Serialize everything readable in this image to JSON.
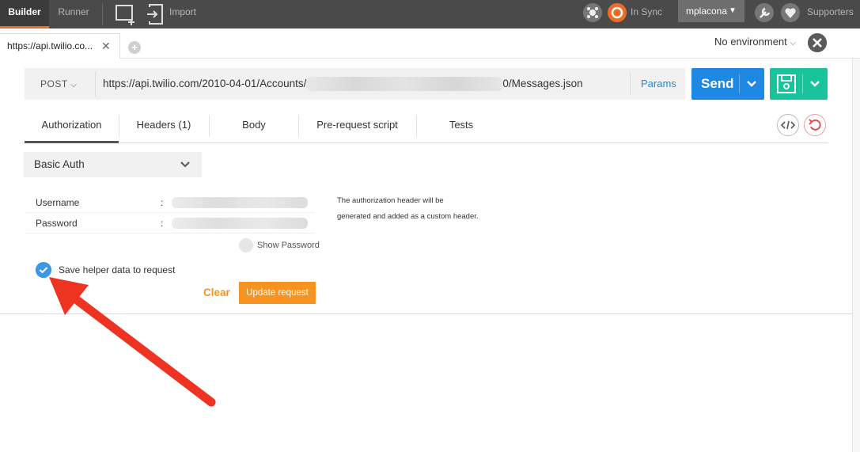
{
  "topbar": {
    "builder": "Builder",
    "runner": "Runner",
    "import": "Import",
    "sync_status": "In Sync",
    "user": "mplacona",
    "supporters": "Supporters",
    "accent": "#ef6c24"
  },
  "tabs": [
    {
      "label": "https://api.twilio.co..."
    }
  ],
  "environment": {
    "selected": "No environment"
  },
  "request": {
    "method": "POST",
    "url_prefix": "https://api.twilio.com/2010-04-01/Accounts/",
    "url_suffix": "0/Messages.json",
    "params": "Params",
    "send": "Send"
  },
  "subtabs": [
    "Authorization",
    "Headers (1)",
    "Body",
    "Pre-request script",
    "Tests"
  ],
  "auth": {
    "type": "Basic Auth",
    "username_label": "Username",
    "password_label": "Password",
    "colon": ":",
    "note_line1": "The authorization header will be",
    "note_line2": "generated and added as a custom header.",
    "show_password": "Show Password",
    "save_helper": "Save helper data to request",
    "clear": "Clear",
    "update": "Update request"
  },
  "colors": {
    "send": "#1e88e5",
    "save": "#19c39c",
    "update": "#f7931e",
    "annotation_arrow": "#ee3322"
  },
  "icons": {
    "new": "new-window-icon",
    "import": "import-icon",
    "interceptor": "interceptor-icon",
    "sync": "sync-icon",
    "settings": "wrench-icon",
    "supporters": "heart-icon",
    "save": "floppy-disk-icon",
    "code": "code-icon",
    "reset": "reset-icon",
    "env_manage": "environment-settings-icon"
  }
}
